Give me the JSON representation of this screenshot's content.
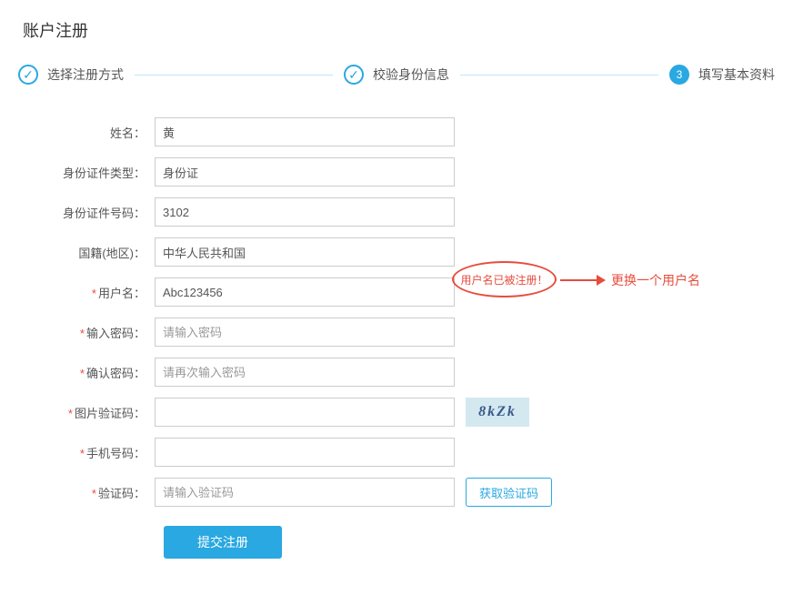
{
  "title": "账户注册",
  "steps": {
    "s1": "选择注册方式",
    "s2": "校验身份信息",
    "s3_num": "3",
    "s3": "填写基本资料"
  },
  "labels": {
    "name": "姓名：",
    "id_type": "身份证件类型：",
    "id_number": "身份证件号码：",
    "nationality": "国籍(地区)：",
    "username": "用户名：",
    "password": "输入密码：",
    "confirm_password": "确认密码：",
    "captcha": "图片验证码：",
    "phone": "手机号码：",
    "sms_code": "验证码："
  },
  "values": {
    "name": "黄",
    "id_type": "身份证",
    "id_number": "3102",
    "nationality": "中华人民共和国",
    "username": "Abc123456"
  },
  "placeholders": {
    "password": "请输入密码",
    "confirm_password": "请再次输入密码",
    "sms_code": "请输入验证码"
  },
  "captcha_text": "8kZk",
  "buttons": {
    "get_code": "获取验证码",
    "submit": "提交注册"
  },
  "error": {
    "username_taken": "用户名已被注册！",
    "hint": "更换一个用户名"
  }
}
